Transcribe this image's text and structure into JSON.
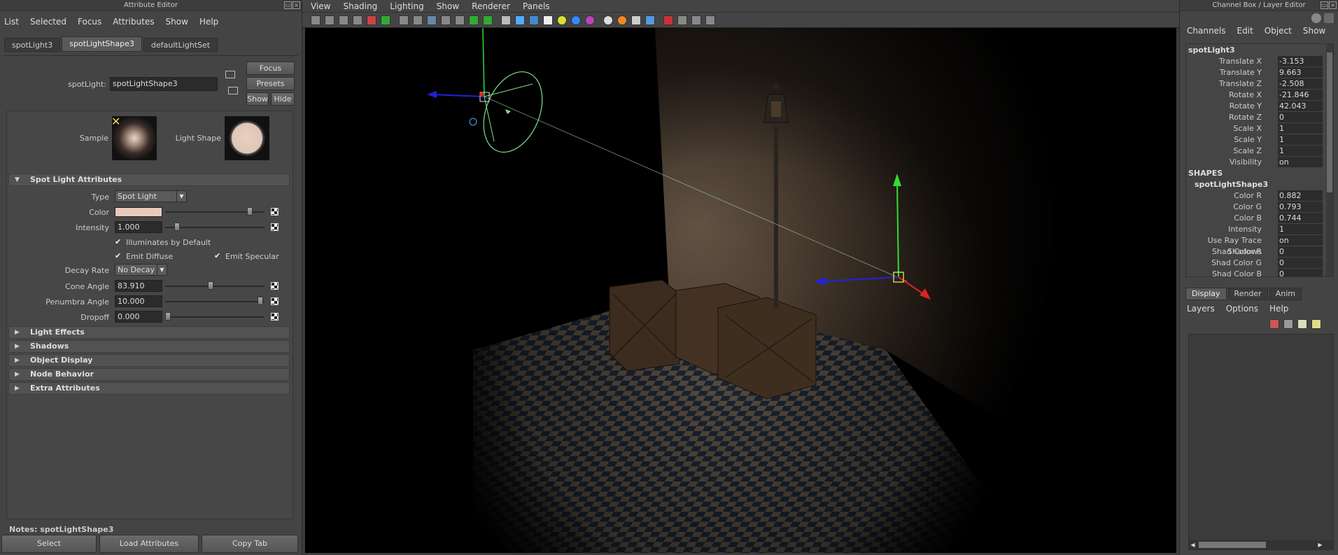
{
  "attribute_editor": {
    "title": "Attribute Editor",
    "menu": [
      "List",
      "Selected",
      "Focus",
      "Attributes",
      "Show",
      "Help"
    ],
    "tabs": [
      "spotLight3",
      "spotLightShape3",
      "defaultLightSet"
    ],
    "node_label": "spotLight:",
    "node_value": "spotLightShape3",
    "buttons": {
      "focus": "Focus",
      "presets": "Presets",
      "show": "Show",
      "hide": "Hide"
    },
    "sample_label": "Sample",
    "light_shape_label": "Light Shape",
    "section_title": "Spot Light Attributes",
    "attrs": {
      "type_label": "Type",
      "type_value": "Spot Light",
      "color_label": "Color",
      "color_swatch": "#e8cabb",
      "intensity_label": "Intensity",
      "intensity_value": "1.000",
      "illum_label": "Illuminates by Default",
      "emit_diffuse_label": "Emit Diffuse",
      "emit_specular_label": "Emit Specular",
      "decay_label": "Decay Rate",
      "decay_value": "No Decay",
      "cone_label": "Cone Angle",
      "cone_value": "83.910",
      "penumbra_label": "Penumbra Angle",
      "penumbra_value": "10.000",
      "dropoff_label": "Dropoff",
      "dropoff_value": "0.000"
    },
    "collapsed_sections": [
      "Light Effects",
      "Shadows",
      "Object Display",
      "Node Behavior",
      "Extra Attributes"
    ],
    "notes": "Notes: spotLightShape3",
    "bottom_buttons": [
      "Select",
      "Load Attributes",
      "Copy Tab"
    ]
  },
  "viewport": {
    "menu": [
      "View",
      "Shading",
      "Lighting",
      "Show",
      "Renderer",
      "Panels"
    ]
  },
  "channel_box": {
    "title": "Channel Box / Layer Editor",
    "menu": [
      "Channels",
      "Edit",
      "Object",
      "Show"
    ],
    "node": "spotLight3",
    "channels": [
      {
        "name": "Translate X",
        "value": "-3.153"
      },
      {
        "name": "Translate Y",
        "value": "9.663"
      },
      {
        "name": "Translate Z",
        "value": "-2.508"
      },
      {
        "name": "Rotate X",
        "value": "-21.846"
      },
      {
        "name": "Rotate Y",
        "value": "42.043"
      },
      {
        "name": "Rotate Z",
        "value": "0"
      },
      {
        "name": "Scale X",
        "value": "1"
      },
      {
        "name": "Scale Y",
        "value": "1"
      },
      {
        "name": "Scale Z",
        "value": "1"
      },
      {
        "name": "Visibility",
        "value": "on"
      }
    ],
    "shapes_label": "SHAPES",
    "shape_node": "spotLightShape3",
    "shape_channels": [
      {
        "name": "Color R",
        "value": "0.882"
      },
      {
        "name": "Color G",
        "value": "0.793"
      },
      {
        "name": "Color B",
        "value": "0.744"
      },
      {
        "name": "Intensity",
        "value": "1"
      },
      {
        "name": "Use Ray Trace Shadows",
        "value": "on"
      },
      {
        "name": "Shad Color R",
        "value": "0"
      },
      {
        "name": "Shad Color G",
        "value": "0"
      },
      {
        "name": "Shad Color B",
        "value": "0"
      }
    ],
    "layer_tabs": [
      "Display",
      "Render",
      "Anim"
    ],
    "layer_menu": [
      "Layers",
      "Options",
      "Help"
    ]
  }
}
